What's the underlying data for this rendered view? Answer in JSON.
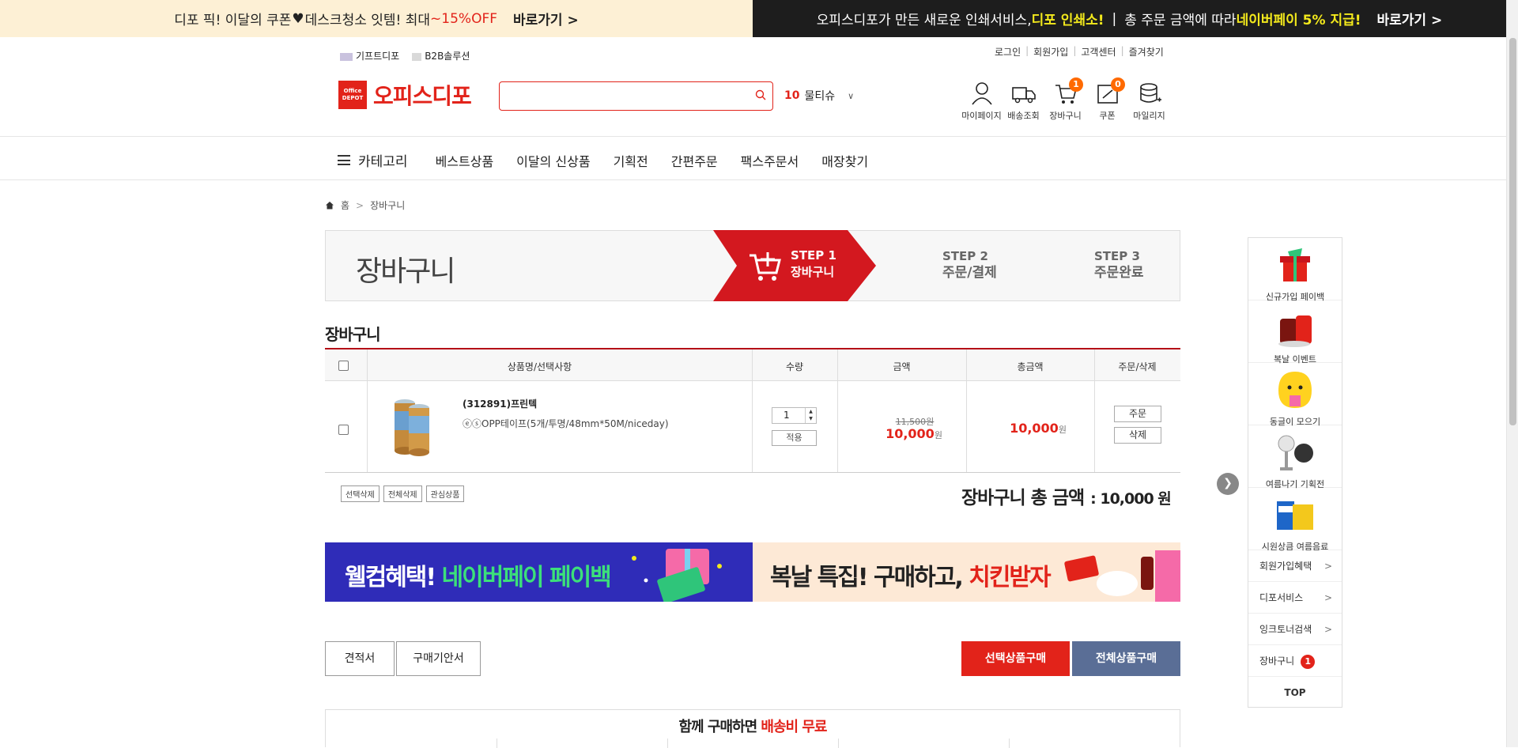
{
  "top_banner": {
    "left_pre": "디포 픽! 이달의 쿠폰",
    "left_mid": "데스크청소 잇템! 최대 ",
    "left_red": "~15%OFF",
    "left_go": "바로가기 >",
    "right_pre": "오피스디포가 만든 새로운 인쇄서비스, ",
    "right_yel1": "디포 인쇄소!",
    "right_sep": "|",
    "right_mid": "총 주문 금액에 따라 ",
    "right_yel2": "네이버페이 5% 지급!",
    "right_go": "바로가기 >"
  },
  "util": {
    "gift": "기프트디포",
    "b2b": "B2B솔루션",
    "login": "로그인",
    "join": "회원가입",
    "cs": "고객센터",
    "fav": "즐겨찾기"
  },
  "logo": {
    "mark": "Office DEPOT",
    "name": "오피스디포"
  },
  "search": {
    "placeholder": ""
  },
  "trend": {
    "num": "10",
    "word": "물티슈",
    "chev": "∨"
  },
  "header_icons": [
    {
      "label": "마이페이지",
      "count": null
    },
    {
      "label": "배송조회",
      "count": null
    },
    {
      "label": "장바구니",
      "count": "1"
    },
    {
      "label": "쿠폰",
      "count": "0"
    },
    {
      "label": "마일리지",
      "count": null
    }
  ],
  "gnb": {
    "category": "카테고리",
    "items": [
      "베스트상품",
      "이달의 신상품",
      "기획전",
      "간편주문",
      "팩스주문서",
      "매장찾기"
    ]
  },
  "breadcrumb": {
    "home": "홈",
    "sep": ">",
    "current": "장바구니"
  },
  "steps": {
    "title": "장바구니",
    "s1": "STEP 1",
    "s1_name": "장바구니",
    "s2": "STEP 2",
    "s2_name": "주문/결제",
    "s3": "STEP 3",
    "s3_name": "주문완료"
  },
  "cart": {
    "heading": "장바구니",
    "columns": [
      "상품명/선택사항",
      "수량",
      "금액",
      "총금액",
      "주문/삭제"
    ],
    "items": [
      {
        "name": "(312891)프린텍",
        "option": "ⓔⓢOPP테이프(5개/투명/48mm*50M/niceday)",
        "qty": "1",
        "apply": "적용",
        "orig_price": "11,500원",
        "price": "10,000",
        "unit": "원",
        "total": "10,000",
        "order": "주문",
        "delete": "삭제"
      }
    ],
    "actions": [
      "선택삭제",
      "전체삭제",
      "관심상품"
    ],
    "total_label": "장바구니 총 금액",
    "total_value": ": 10,000 원"
  },
  "banners": {
    "b1_pre": "웰컴혜택! ",
    "b1_green": "네이버페이 페이백",
    "b2_pre": "복날 특집! 구매하고, ",
    "b2_red": "치킨받자"
  },
  "buttons": {
    "quote": "견적서",
    "guide": "구매기안서",
    "buy_selected": "선택상품구매",
    "buy_all": "전체상품구매"
  },
  "together": {
    "pre": "함께 구매하면 ",
    "red": "배송비 무료"
  },
  "quick_menu": {
    "items": [
      "신규가입 페이백",
      "복날 이벤트",
      "동글이 모으기",
      "여름나기 기획전",
      "시원상큼 여름음료"
    ],
    "links": [
      "회원가입혜택",
      "디포서비스",
      "잉크토너검색"
    ],
    "cart": "장바구니",
    "cart_count": "1",
    "top": "TOP"
  },
  "colors": {
    "brand_red": "#e2231a",
    "dark_red": "#b50f17",
    "buy_all_blue": "#5a6e96"
  }
}
